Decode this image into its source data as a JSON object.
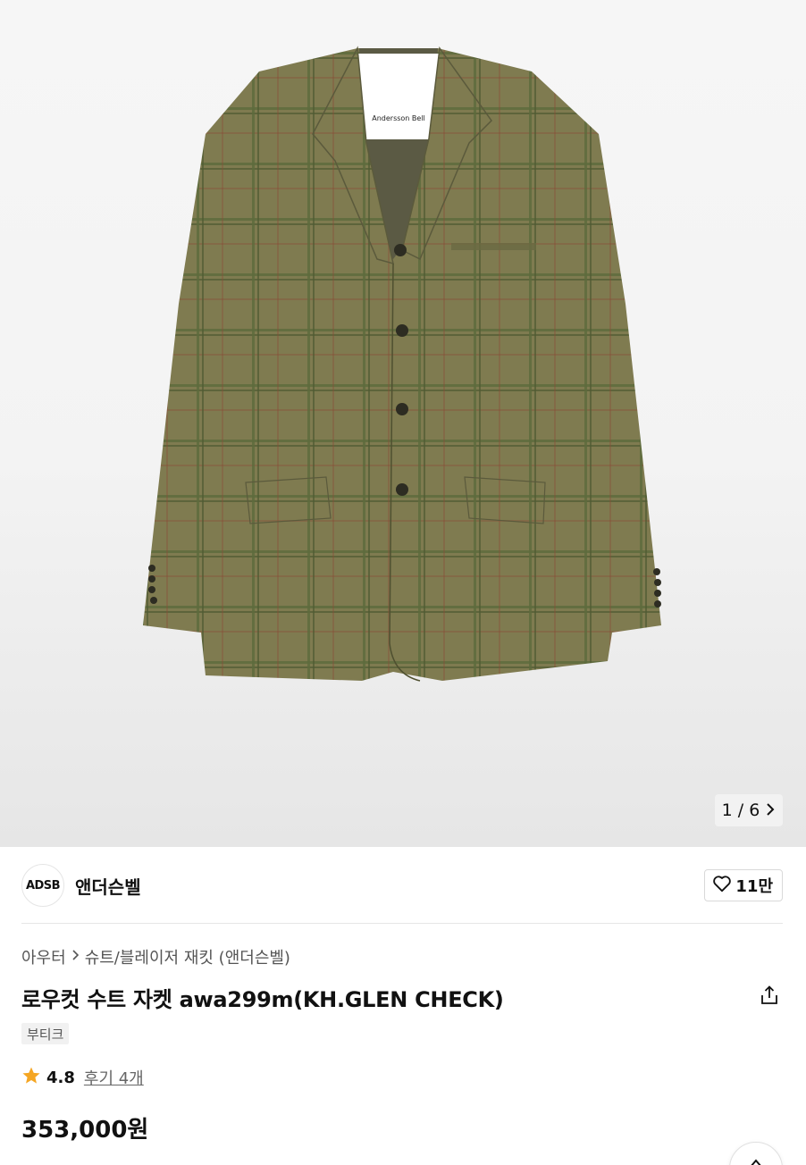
{
  "gallery": {
    "image_alt": "로우컷 수트 자켓 awa299m(KH.GLEN CHECK)",
    "label_text": "Andersson Bell",
    "pager_text": "1 / 6"
  },
  "brand": {
    "logo_text": "ADSB",
    "name": "앤더슨벨",
    "like_count": "11만"
  },
  "breadcrumb": {
    "items": [
      "아우터",
      "슈트/블레이저 재킷 (앤더슨벨)"
    ]
  },
  "product": {
    "title": "로우컷 수트 자켓 awa299m(KH.GLEN CHECK)",
    "badge": "부티크",
    "rating": "4.8",
    "reviews": "후기 4개",
    "price": "353,000원"
  },
  "icons": {
    "pager_next": "chevron-right-icon",
    "like": "heart-icon",
    "share": "share-icon",
    "star": "star-icon",
    "scroll_top": "arrow-up-icon"
  },
  "colors": {
    "star": "#F5A623",
    "jacket": "#7d7a4e"
  }
}
